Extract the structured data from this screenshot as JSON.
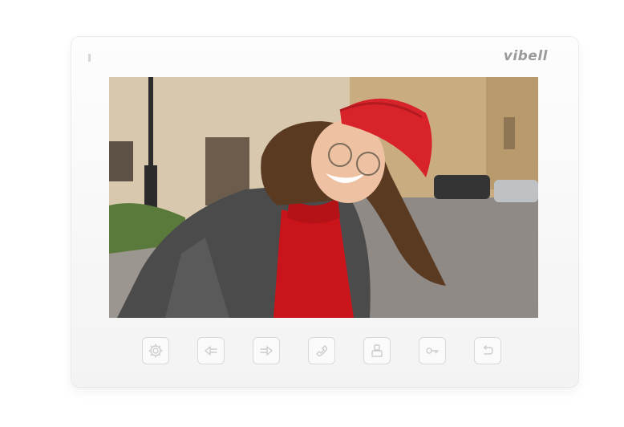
{
  "device": {
    "brand": "vibell"
  },
  "screen": {
    "content": "live-video-feed"
  },
  "controls": [
    {
      "id": "settings",
      "icon": "gear-icon"
    },
    {
      "id": "monitor-left",
      "icon": "arrow-left-icon"
    },
    {
      "id": "monitor-right",
      "icon": "arrow-right-icon"
    },
    {
      "id": "talk",
      "icon": "phone-handset-icon"
    },
    {
      "id": "intercom",
      "icon": "person-icon"
    },
    {
      "id": "unlock",
      "icon": "key-icon"
    },
    {
      "id": "back",
      "icon": "return-icon"
    }
  ],
  "colors": {
    "frame": "#f7f7f7",
    "button_border": "#d9d9d9",
    "brand": "#9a9a9a"
  }
}
